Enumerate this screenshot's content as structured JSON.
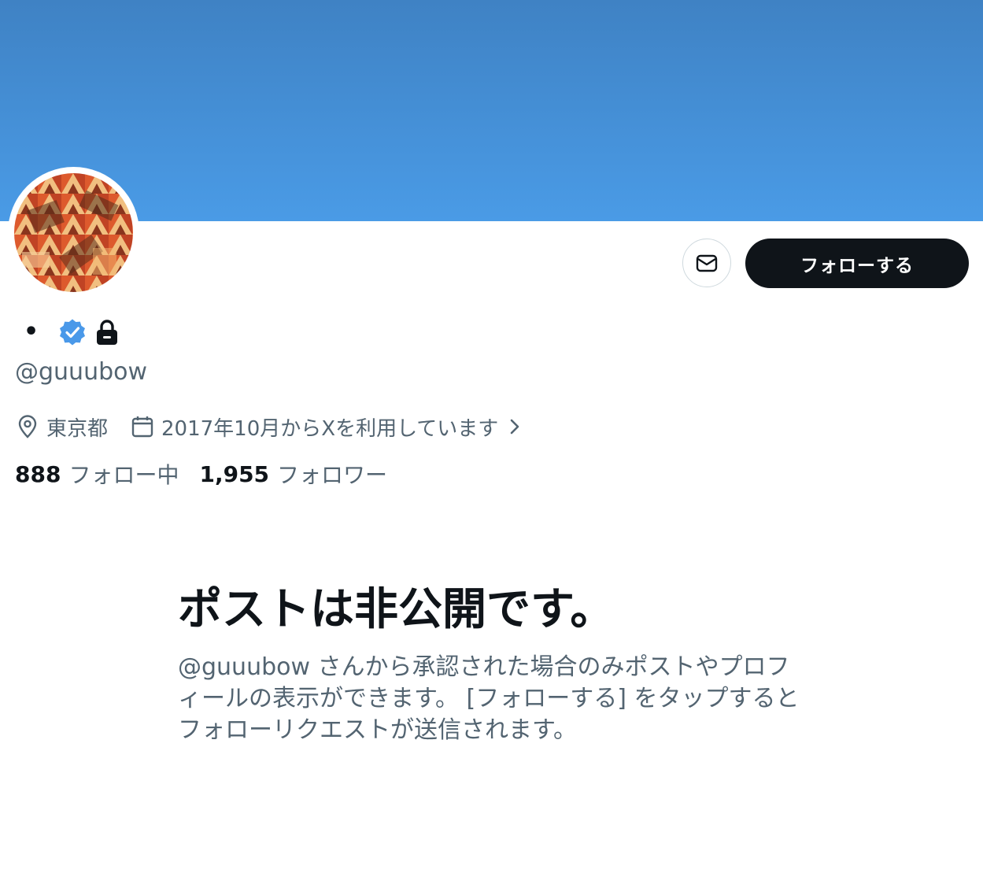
{
  "profile": {
    "display_name": "•",
    "handle": "@guuubow",
    "location": "東京都",
    "joined": "2017年10月からXを利用しています",
    "following_count": "888",
    "following_label": "フォロー中",
    "followers_count": "1,955",
    "followers_label": "フォロワー"
  },
  "actions": {
    "follow_label": "フォローする"
  },
  "private_notice": {
    "title": "ポストは非公開です。",
    "description": "@guuubow さんから承認された場合のみポストやプロフィールの表示ができます。 [フォローする] をタップするとフォローリクエストが送信されます。"
  },
  "colors": {
    "banner_top": "#3f82c4",
    "banner_bottom": "#4a9be6",
    "verified_badge": "#4a99e9",
    "follow_button": "#0f1419",
    "secondary_text": "#536471"
  },
  "icons": {
    "message": "envelope-icon",
    "verified": "verified-badge-icon",
    "protected": "lock-icon",
    "location": "location-pin-icon",
    "joined": "calendar-icon",
    "joined_more": "chevron-right-icon"
  }
}
